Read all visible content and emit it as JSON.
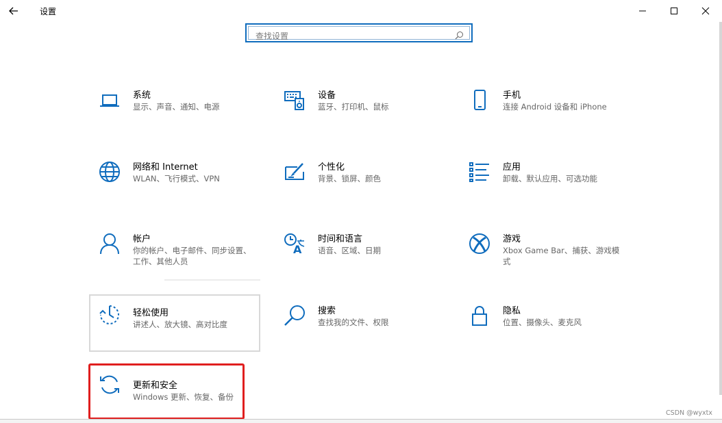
{
  "window": {
    "title": "设置"
  },
  "search": {
    "placeholder": "查找设置"
  },
  "tiles": [
    {
      "title": "系统",
      "desc": "显示、声音、通知、电源",
      "icon": "laptop-icon"
    },
    {
      "title": "设备",
      "desc": "蓝牙、打印机、鼠标",
      "icon": "keyboard-devices-icon"
    },
    {
      "title": "手机",
      "desc": "连接 Android 设备和 iPhone",
      "icon": "phone-icon"
    },
    {
      "title": "网络和 Internet",
      "desc": "WLAN、飞行模式、VPN",
      "icon": "globe-icon"
    },
    {
      "title": "个性化",
      "desc": "背景、锁屏、颜色",
      "icon": "paint-brush-icon"
    },
    {
      "title": "应用",
      "desc": "卸载、默认应用、可选功能",
      "icon": "apps-list-icon"
    },
    {
      "title": "帐户",
      "desc": "你的帐户、电子邮件、同步设置、工作、其他人员",
      "icon": "person-icon"
    },
    {
      "title": "时间和语言",
      "desc": "语音、区域、日期",
      "icon": "time-language-icon"
    },
    {
      "title": "游戏",
      "desc": "Xbox Game Bar、捕获、游戏模式",
      "icon": "xbox-icon"
    },
    {
      "title": "轻松使用",
      "desc": "讲述人、放大镜、高对比度",
      "icon": "ease-of-access-icon"
    },
    {
      "title": "搜索",
      "desc": "查找我的文件、权限",
      "icon": "search-magnifier-icon"
    },
    {
      "title": "隐私",
      "desc": "位置、摄像头、麦克风",
      "icon": "lock-icon"
    },
    {
      "title": "更新和安全",
      "desc": "Windows 更新、恢复、备份",
      "icon": "sync-icon"
    }
  ],
  "watermark": "CSDN @wyxtx",
  "colors": {
    "accent": "#0f6cbd",
    "highlight": "#e01e1e"
  }
}
